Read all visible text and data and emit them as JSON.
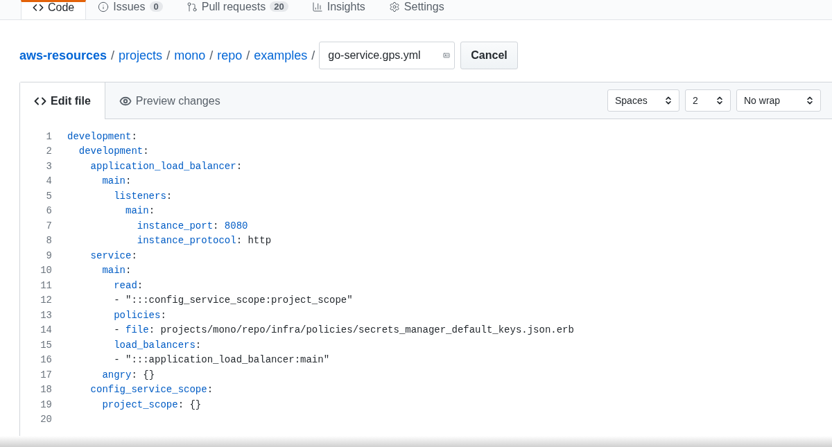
{
  "repo_tabs": [
    {
      "label": "Code",
      "selected": true
    },
    {
      "label": "Issues",
      "count": "0",
      "selected": false
    },
    {
      "label": "Pull requests",
      "count": "20",
      "selected": false
    },
    {
      "label": "Insights",
      "selected": false
    },
    {
      "label": "Settings",
      "selected": false
    }
  ],
  "breadcrumb": {
    "root": "aws-resources",
    "parts": [
      "projects",
      "mono",
      "repo",
      "examples"
    ],
    "separator": "/"
  },
  "filename": {
    "value": "go-service.gps.yml"
  },
  "cancel_button": "Cancel",
  "editor_tabs": [
    {
      "label": "Edit file",
      "selected": true
    },
    {
      "label": "Preview changes",
      "selected": false
    }
  ],
  "selects": [
    {
      "value": "Spaces"
    },
    {
      "value": "2"
    },
    {
      "value": "No wrap"
    }
  ],
  "code_lines": [
    {
      "number": "1",
      "tokens": [
        {
          "kind": "key",
          "text": "development"
        },
        {
          "kind": "plain",
          "text": ":"
        }
      ]
    },
    {
      "number": "2",
      "tokens": [
        {
          "kind": "key",
          "text": "  development"
        },
        {
          "kind": "plain",
          "text": ":"
        }
      ]
    },
    {
      "number": "3",
      "tokens": [
        {
          "kind": "key",
          "text": "    application_load_balancer"
        },
        {
          "kind": "plain",
          "text": ":"
        }
      ]
    },
    {
      "number": "4",
      "tokens": [
        {
          "kind": "key",
          "text": "      main"
        },
        {
          "kind": "plain",
          "text": ":"
        }
      ]
    },
    {
      "number": "5",
      "tokens": [
        {
          "kind": "key",
          "text": "        listeners"
        },
        {
          "kind": "plain",
          "text": ":"
        }
      ]
    },
    {
      "number": "6",
      "tokens": [
        {
          "kind": "key",
          "text": "          main"
        },
        {
          "kind": "plain",
          "text": ":"
        }
      ]
    },
    {
      "number": "7",
      "tokens": [
        {
          "kind": "key",
          "text": "            instance_port"
        },
        {
          "kind": "plain",
          "text": ": "
        },
        {
          "kind": "number",
          "text": "8080"
        }
      ]
    },
    {
      "number": "8",
      "tokens": [
        {
          "kind": "key",
          "text": "            instance_protocol"
        },
        {
          "kind": "plain",
          "text": ": http"
        }
      ]
    },
    {
      "number": "9",
      "tokens": [
        {
          "kind": "key",
          "text": "    service"
        },
        {
          "kind": "plain",
          "text": ":"
        }
      ]
    },
    {
      "number": "10",
      "tokens": [
        {
          "kind": "key",
          "text": "      main"
        },
        {
          "kind": "plain",
          "text": ":"
        }
      ]
    },
    {
      "number": "11",
      "tokens": [
        {
          "kind": "key",
          "text": "        read"
        },
        {
          "kind": "plain",
          "text": ":"
        }
      ]
    },
    {
      "number": "12",
      "tokens": [
        {
          "kind": "plain",
          "text": "        - \":::config_service_scope:project_scope\""
        }
      ]
    },
    {
      "number": "13",
      "tokens": [
        {
          "kind": "key",
          "text": "        policies"
        },
        {
          "kind": "plain",
          "text": ":"
        }
      ]
    },
    {
      "number": "14",
      "tokens": [
        {
          "kind": "plain",
          "text": "        - "
        },
        {
          "kind": "key",
          "text": "file"
        },
        {
          "kind": "plain",
          "text": ": projects/mono/repo/infra/policies/secrets_manager_default_keys.json.erb"
        }
      ]
    },
    {
      "number": "15",
      "tokens": [
        {
          "kind": "key",
          "text": "        load_balancers"
        },
        {
          "kind": "plain",
          "text": ":"
        }
      ]
    },
    {
      "number": "16",
      "tokens": [
        {
          "kind": "plain",
          "text": "        - \":::application_load_balancer:main\""
        }
      ]
    },
    {
      "number": "17",
      "tokens": [
        {
          "kind": "key",
          "text": "      angry"
        },
        {
          "kind": "plain",
          "text": ": {}"
        }
      ]
    },
    {
      "number": "18",
      "tokens": [
        {
          "kind": "key",
          "text": "    config_service_scope"
        },
        {
          "kind": "plain",
          "text": ":"
        }
      ]
    },
    {
      "number": "19",
      "tokens": [
        {
          "kind": "key",
          "text": "      project_scope"
        },
        {
          "kind": "plain",
          "text": ": {}"
        }
      ]
    },
    {
      "number": "20"
    }
  ]
}
